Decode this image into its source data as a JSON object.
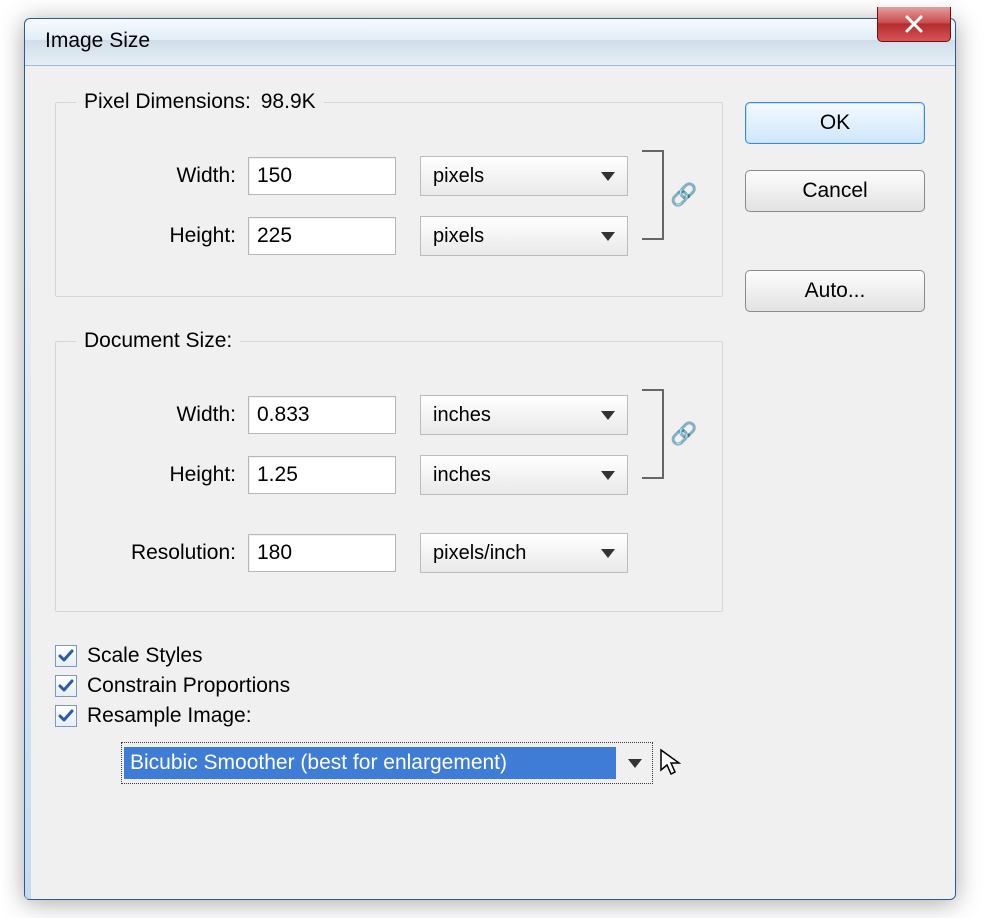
{
  "window": {
    "title": "Image Size",
    "close_sr": "Close"
  },
  "pixel_dimensions": {
    "legend_label": "Pixel Dimensions:",
    "legend_value": "98.9K",
    "width_label": "Width:",
    "width_value": "150",
    "width_unit": "pixels",
    "height_label": "Height:",
    "height_value": "225",
    "height_unit": "pixels"
  },
  "document_size": {
    "legend_label": "Document Size:",
    "width_label": "Width:",
    "width_value": "0.833",
    "width_unit": "inches",
    "height_label": "Height:",
    "height_value": "1.25",
    "height_unit": "inches",
    "resolution_label": "Resolution:",
    "resolution_value": "180",
    "resolution_unit": "pixels/inch"
  },
  "checks": {
    "scale_styles": "Scale Styles",
    "constrain": "Constrain Proportions",
    "resample": "Resample Image:"
  },
  "resample_method": {
    "selected": "Bicubic Smoother (best for enlargement)"
  },
  "buttons": {
    "ok": "OK",
    "cancel": "Cancel",
    "auto": "Auto..."
  }
}
